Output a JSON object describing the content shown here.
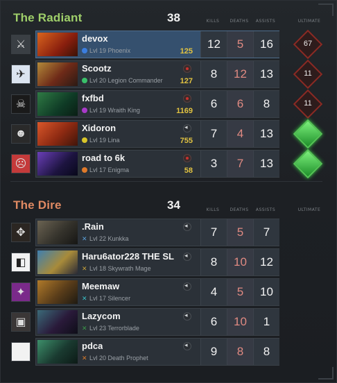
{
  "radiant": {
    "title": "The Radiant",
    "score": "38",
    "columns": [
      "KILLS",
      "DEATHS",
      "ASSISTS",
      "ULTIMATE"
    ],
    "players": [
      {
        "name": "devox",
        "level": "Lvl 19",
        "hero": "Phoenix",
        "gold": "125",
        "kills": "12",
        "deaths": "5",
        "assists": "16",
        "ult": "67",
        "ult_state": "cooldown",
        "indicator": "none",
        "highlight": true
      },
      {
        "name": "Scootz",
        "level": "Lvl 20",
        "hero": "Legion Commander",
        "gold": "127",
        "kills": "8",
        "deaths": "12",
        "assists": "13",
        "ult": "11",
        "ult_state": "cooldown",
        "indicator": "rec"
      },
      {
        "name": "fxfbd",
        "level": "Lvl 19",
        "hero": "Wraith King",
        "gold": "1169",
        "kills": "6",
        "deaths": "6",
        "assists": "8",
        "ult": "11",
        "ult_state": "cooldown",
        "indicator": "rec"
      },
      {
        "name": "Xidoron",
        "level": "Lvl 19",
        "hero": "Lina",
        "gold": "755",
        "kills": "7",
        "deaths": "4",
        "assists": "13",
        "ult": "",
        "ult_state": "ready",
        "indicator": "spk"
      },
      {
        "name": "road to 6k",
        "level": "Lvl 17",
        "hero": "Enigma",
        "gold": "58",
        "kills": "3",
        "deaths": "7",
        "assists": "13",
        "ult": "",
        "ult_state": "ready",
        "indicator": "rec"
      }
    ]
  },
  "dire": {
    "title": "The Dire",
    "score": "34",
    "columns": [
      "KILLS",
      "DEATHS",
      "ASSISTS",
      "ULTIMATE"
    ],
    "players": [
      {
        "name": ".Rain",
        "level": "Lvl 22",
        "hero": "Kunkka",
        "kills": "7",
        "deaths": "5",
        "assists": "7",
        "indicator": "spk"
      },
      {
        "name": "Haru6ator228 THE SL",
        "level": "Lvl 18",
        "hero": "Skywrath Mage",
        "kills": "8",
        "deaths": "10",
        "assists": "12",
        "indicator": "spk"
      },
      {
        "name": "Meemaw",
        "level": "Lvl 17",
        "hero": "Silencer",
        "kills": "4",
        "deaths": "5",
        "assists": "10",
        "indicator": "spk"
      },
      {
        "name": "Lazycom",
        "level": "Lvl 23",
        "hero": "Terrorblade",
        "kills": "6",
        "deaths": "10",
        "assists": "1",
        "indicator": "spk"
      },
      {
        "name": "pdca",
        "level": "Lvl 20",
        "hero": "Death Prophet",
        "kills": "9",
        "deaths": "8",
        "assists": "8",
        "indicator": "spk"
      }
    ]
  },
  "colors": {
    "radiant_title": "#9fcf6a",
    "dire_title": "#e08a63",
    "gold": "#e2c341",
    "death": "#e08a82",
    "ult_ready": "#3fd14a",
    "ult_cooldown": "#8a2a24"
  }
}
